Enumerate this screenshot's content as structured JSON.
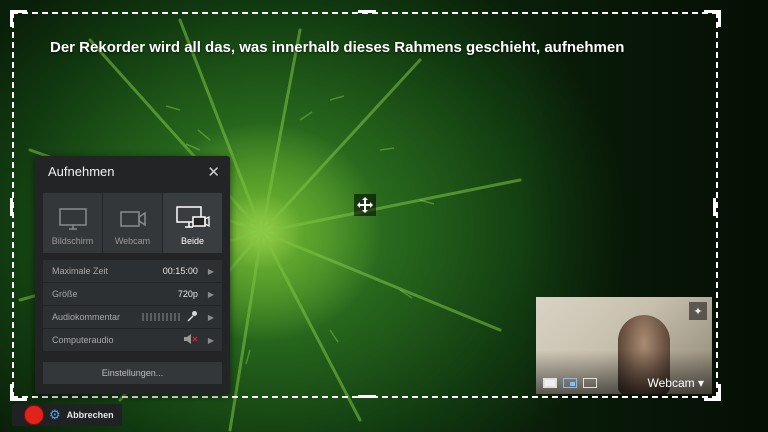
{
  "overlay": {
    "headline": "Der Rekorder wird all das, was innerhalb dieses Rahmens geschieht, aufnehmen",
    "move_icon": "move-arrows-icon"
  },
  "panel": {
    "title": "Aufnehmen",
    "close_icon": "close-icon",
    "modes": [
      {
        "label": "Bildschirm",
        "icon": "monitor-icon",
        "active": false
      },
      {
        "label": "Webcam",
        "icon": "video-camera-icon",
        "active": false
      },
      {
        "label": "Beide",
        "icon": "monitor-camera-icon",
        "active": true
      }
    ],
    "rows": [
      {
        "label": "Maximale Zeit",
        "value": "00:15:00"
      },
      {
        "label": "Größe",
        "value": "720p"
      },
      {
        "label": "Audiokommentar",
        "value": ""
      },
      {
        "label": "Computeraudio",
        "value": ""
      }
    ],
    "settings_label": "Einstellungen..."
  },
  "bottombar": {
    "cancel_label": "Abbrechen"
  },
  "webcam": {
    "label": "Webcam ▾"
  },
  "colors": {
    "record": "#e0241b",
    "gear": "#4fa3e8",
    "panel_bg": "#222426"
  }
}
